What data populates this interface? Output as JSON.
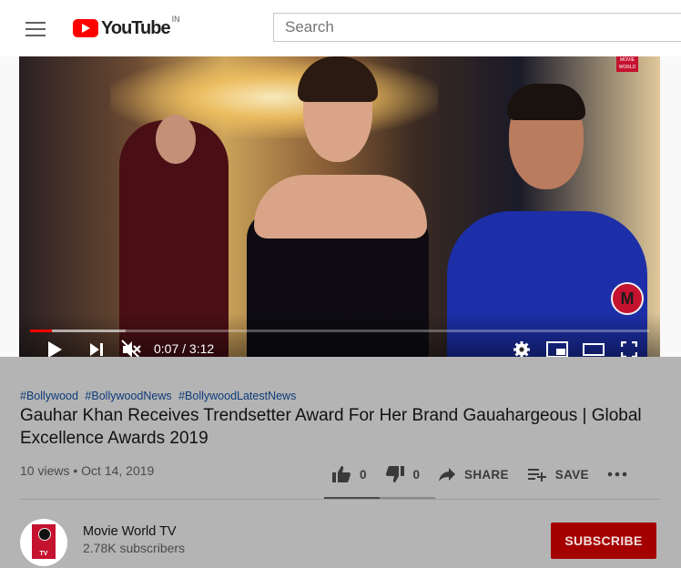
{
  "masthead": {
    "logo_text": "YouTube",
    "country_code": "IN",
    "search_placeholder": "Search"
  },
  "player": {
    "current_time": "0:07",
    "duration": "3:12",
    "time_display": "0:07 / 3:12",
    "progress_fraction": 0.036,
    "buffer_fraction": 0.155,
    "watermark_top_text": "MOVIE WORLD",
    "muted": true
  },
  "video": {
    "hashtags": [
      "#Bollywood",
      "#BollywoodNews",
      "#BollywoodLatestNews"
    ],
    "title": "Gauhar Khan Receives Trendsetter Award For Her Brand Gauahargeous | Global Excellence Awards 2019",
    "meta": "10 views • Oct 14, 2019",
    "likes": "0",
    "dislikes": "0",
    "share_label": "SHARE",
    "save_label": "SAVE",
    "like_ratio": 0.5
  },
  "channel": {
    "name": "Movie World TV",
    "subscribers": "2.78K subscribers",
    "subscribe_label": "SUBSCRIBE"
  },
  "colors": {
    "brand_red": "#ff0000",
    "subscribe_bg": "#a40000",
    "channel_red": "#c4122f"
  }
}
